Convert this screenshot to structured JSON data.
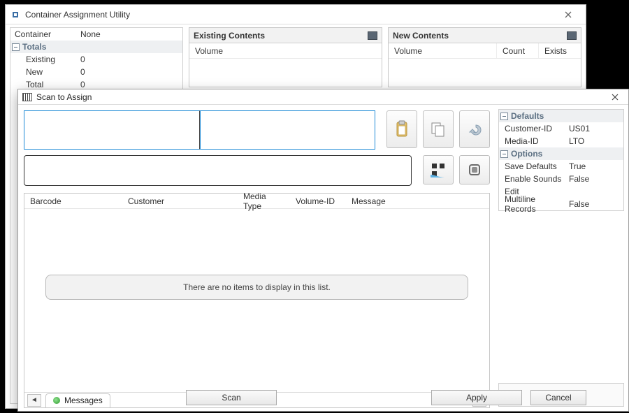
{
  "backWindow": {
    "title": "Container Assignment Utility",
    "container_label": "Container",
    "container_value": "None",
    "totals_label": "Totals",
    "rows": {
      "existing": {
        "label": "Existing",
        "value": "0"
      },
      "new": {
        "label": "New",
        "value": "0"
      },
      "total": {
        "label": "Total",
        "value": "0"
      }
    },
    "existingContents": {
      "title": "Existing Contents",
      "col_volume": "Volume"
    },
    "newContents": {
      "title": "New Contents",
      "col_volume": "Volume",
      "col_count": "Count",
      "col_exists": "Exists"
    }
  },
  "scanWindow": {
    "title": "Scan to Assign",
    "list": {
      "cols": {
        "barcode": "Barcode",
        "customer": "Customer",
        "mediaType": "Media Type",
        "volumeId": "Volume-ID",
        "message": "Message"
      },
      "empty_text": "There are no items to display in this list."
    },
    "tab_messages": "Messages",
    "defaults_label": "Defaults",
    "defaults": {
      "customerId": {
        "label": "Customer-ID",
        "value": "US01"
      },
      "mediaId": {
        "label": "Media-ID",
        "value": "LTO"
      }
    },
    "options_label": "Options",
    "options": {
      "saveDefaults": {
        "label": "Save Defaults",
        "value": "True"
      },
      "enableSounds": {
        "label": "Enable Sounds",
        "value": "False"
      },
      "edit": {
        "label": "Edit",
        "value": ""
      },
      "multiline": {
        "label": "Multiline Records",
        "value": "False"
      }
    },
    "buttons": {
      "scan": "Scan",
      "apply": "Apply",
      "cancel": "Cancel"
    }
  }
}
